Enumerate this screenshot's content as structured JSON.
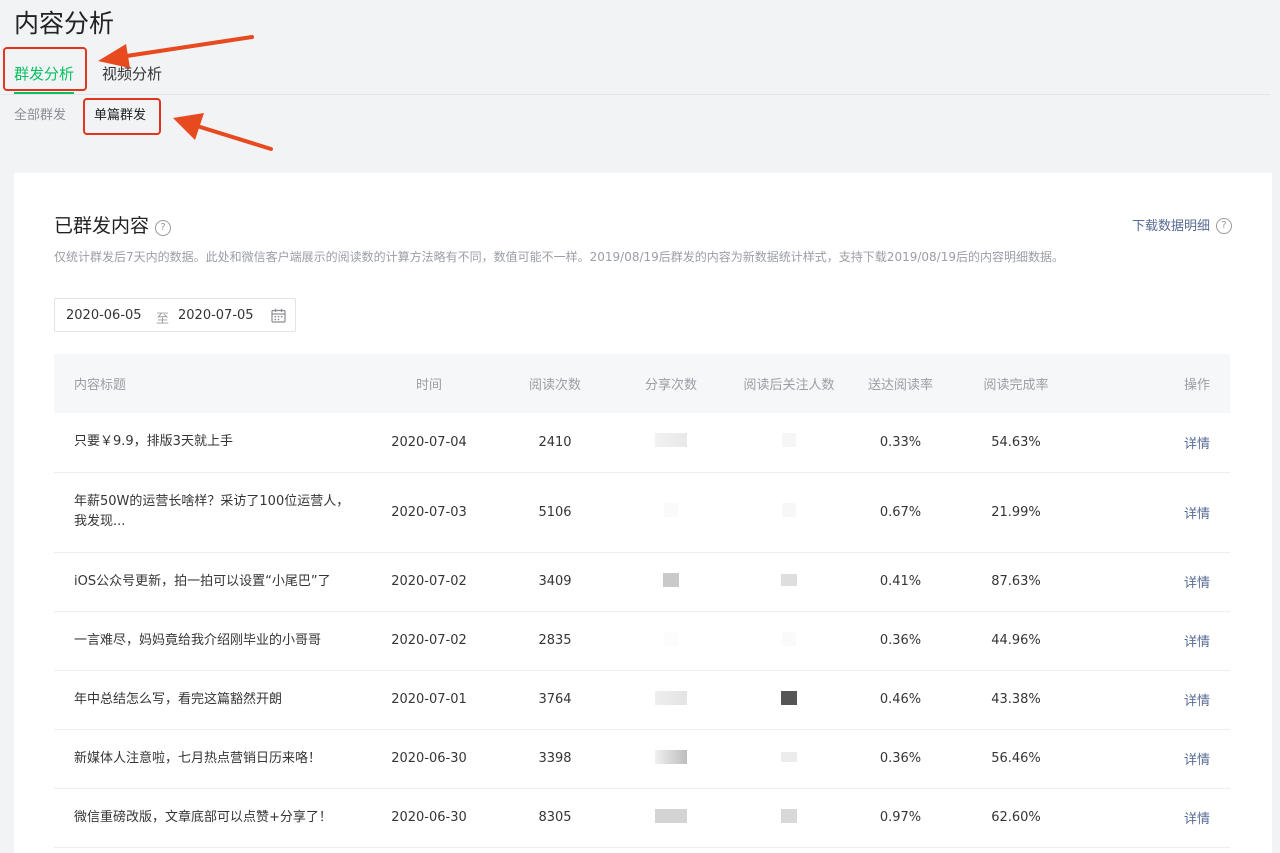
{
  "page": {
    "title": "内容分析"
  },
  "tabs": [
    {
      "label": "群发分析",
      "active": true
    },
    {
      "label": "视频分析",
      "active": false
    }
  ],
  "subtabs": [
    {
      "label": "全部群发",
      "active": false
    },
    {
      "label": "单篇群发",
      "active": true
    }
  ],
  "section": {
    "title": "已群发内容",
    "help_icon": "question-circle-icon",
    "download_label": "下载数据明细",
    "note": "仅统计群发后7天内的数据。此处和微信客户端展示的阅读数的计算方法略有不同，数值可能不一样。2019/08/19后群发的内容为新数据统计样式，支持下载2019/08/19后的内容明细数据。"
  },
  "date_range": {
    "start": "2020-06-05",
    "sep": "至",
    "end": "2020-07-05",
    "icon": "calendar-icon"
  },
  "table": {
    "headers": [
      "内容标题",
      "时间",
      "阅读次数",
      "分享次数",
      "阅读后关注人数",
      "送达阅读率",
      "阅读完成率",
      "操作"
    ],
    "rows": [
      {
        "title": "只要￥9.9，排版3天就上手",
        "time": "2020-07-04",
        "reads": "2410",
        "delivery_rate": "0.33%",
        "completion_rate": "54.63%",
        "action": "详情"
      },
      {
        "title": "年薪50W的运营长啥样？采访了100位运营人，我发现...",
        "time": "2020-07-03",
        "reads": "5106",
        "delivery_rate": "0.67%",
        "completion_rate": "21.99%",
        "action": "详情"
      },
      {
        "title": "iOS公众号更新，拍一拍可以设置“小尾巴”了",
        "time": "2020-07-02",
        "reads": "3409",
        "delivery_rate": "0.41%",
        "completion_rate": "87.63%",
        "action": "详情"
      },
      {
        "title": "一言难尽，妈妈竟给我介绍刚毕业的小哥哥",
        "time": "2020-07-02",
        "reads": "2835",
        "delivery_rate": "0.36%",
        "completion_rate": "44.96%",
        "action": "详情"
      },
      {
        "title": "年中总结怎么写，看完这篇豁然开朗",
        "time": "2020-07-01",
        "reads": "3764",
        "delivery_rate": "0.46%",
        "completion_rate": "43.38%",
        "action": "详情"
      },
      {
        "title": "新媒体人注意啦，七月热点营销日历来咯！",
        "time": "2020-06-30",
        "reads": "3398",
        "delivery_rate": "0.36%",
        "completion_rate": "56.46%",
        "action": "详情"
      },
      {
        "title": "微信重磅改版，文章底部可以点赞+分享了！",
        "time": "2020-06-30",
        "reads": "8305",
        "delivery_rate": "0.97%",
        "completion_rate": "62.60%",
        "action": "详情"
      }
    ]
  },
  "colors": {
    "accent": "#07c160",
    "link": "#576b95",
    "annotation": "#e0351f"
  }
}
